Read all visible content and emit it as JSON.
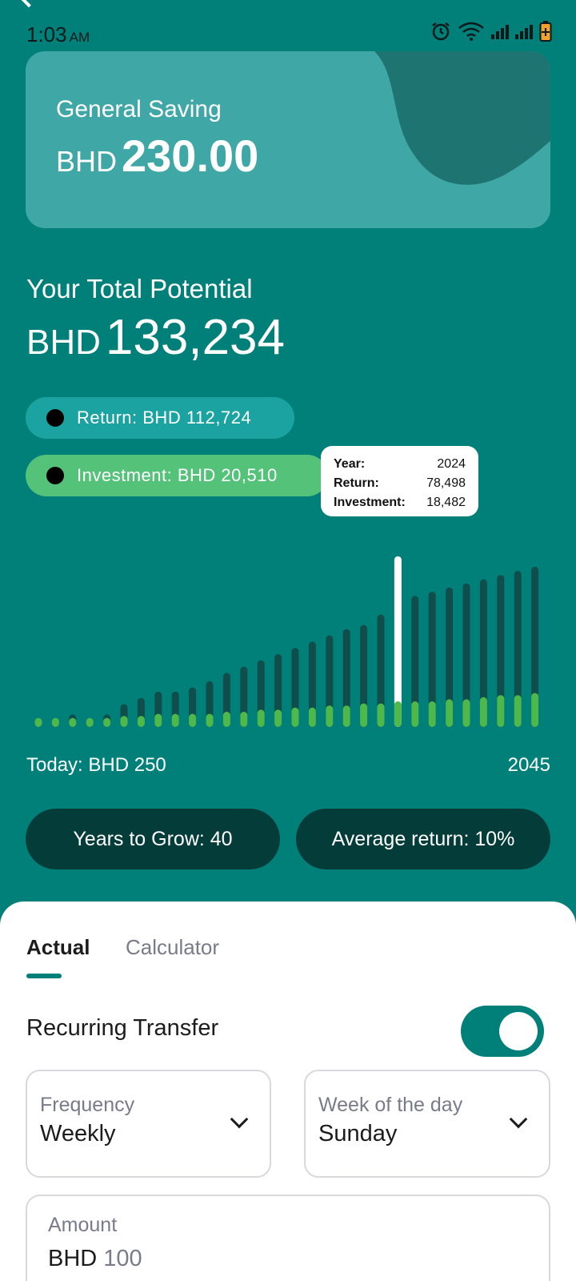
{
  "status_bar": {
    "time": "1:03",
    "ampm": "AM"
  },
  "account": {
    "name": "General Saving",
    "currency": "BHD",
    "balance": "230.00"
  },
  "potential": {
    "label": "Your Total Potential",
    "currency": "BHD",
    "value": "133,234"
  },
  "legend": {
    "return": "Return: BHD 112,724",
    "investment": "Investment: BHD 20,510"
  },
  "tooltip": {
    "year_label": "Year:",
    "year": "2024",
    "return_label": "Return:",
    "return": "78,498",
    "investment_label": "Investment:",
    "investment": "18,482"
  },
  "axis": {
    "left": "Today: BHD 250",
    "right": "2045"
  },
  "chips": {
    "years": "Years to Grow: 40",
    "average": "Average return: 10%"
  },
  "tabs": {
    "actual": "Actual",
    "calculator": "Calculator"
  },
  "recurring": {
    "label": "Recurring Transfer",
    "enabled": true
  },
  "frequency": {
    "label": "Frequency",
    "value": "Weekly"
  },
  "week_day": {
    "label": "Week of the day",
    "value": "Sunday"
  },
  "amount": {
    "label": "Amount",
    "currency": "BHD",
    "value": "100"
  },
  "colors": {
    "background": "#01807a",
    "return_bar": "#0f4e4b",
    "investment_bar": "#4fb84a",
    "highlight_bar": "#ffffff",
    "return_pill": "#1aa3a0",
    "investment_pill": "#55c27a",
    "chip": "#043c3a"
  },
  "chart_data": {
    "type": "bar",
    "selected_index": 21,
    "series": [
      {
        "name": "Return",
        "values": [
          4,
          4,
          6,
          4,
          6,
          11,
          14,
          17,
          17,
          19,
          22,
          26,
          29,
          32,
          35,
          38,
          41,
          44,
          47,
          49,
          54,
          82,
          63,
          65,
          67,
          69,
          71,
          73,
          75,
          77
        ]
      },
      {
        "name": "Investment",
        "values": [
          2,
          2,
          2,
          2,
          2,
          3,
          3,
          4,
          4,
          4,
          4,
          5,
          5,
          6,
          6,
          7,
          7,
          8,
          8,
          9,
          9,
          10,
          10,
          10,
          11,
          11,
          12,
          13,
          13,
          14
        ]
      }
    ]
  }
}
